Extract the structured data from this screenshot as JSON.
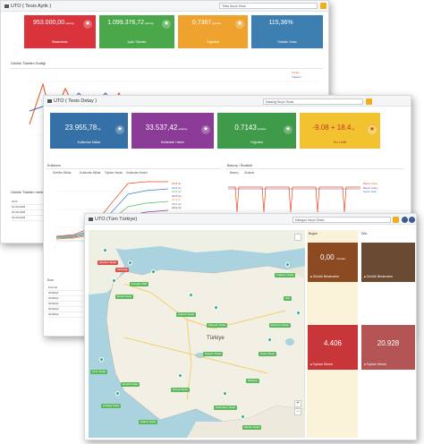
{
  "panel1": {
    "title": "UTO ( Tesis Aylık )",
    "select": "Tesis Seçin Tesis",
    "kpis": [
      {
        "value": "953.000,00",
        "unit": "adet/ay",
        "label": "Beslemeler",
        "color": "#d9343c"
      },
      {
        "value": "1.099.376,72",
        "unit": "adet/ay",
        "label": "Aylık Tüketim",
        "color": "#4aa84a"
      },
      {
        "value": "0,7367",
        "unit": "kg/adet",
        "label": "Yoğunluk",
        "color": "#f0a22e"
      },
      {
        "value": "115,36%",
        "unit": "",
        "label": "Tüketim Oranı",
        "color": "#3c7fb0"
      }
    ],
    "chart_title": "Günlük Tüketim Grafiği",
    "legend": [
      "Üretim",
      "Tüketim"
    ],
    "table_header": "Günlük Tüketim Verileri",
    "table_rows": [
      "Tarih",
      "01.09.2018",
      "02.09.2018",
      "03.09.2018"
    ]
  },
  "panel2": {
    "title": "UTO ( Tesis Detay )",
    "select": "Katalog Seçin Tesisi",
    "kpis": [
      {
        "value": "23.955,78",
        "unit": "kg",
        "label": "Kullanılan Miktar",
        "color": "#3571a6"
      },
      {
        "value": "33.537,42",
        "unit": "adet/ay",
        "label": "Kullanılan Hacim",
        "color": "#8a3c96"
      },
      {
        "value": "0.7143",
        "unit": "kg/adet",
        "label": "Yoğunluk",
        "color": "#3f9a4a"
      },
      {
        "value": "-9.08 + 18.4",
        "unit": "ay",
        "label": "Hız Limiti",
        "color": "#f2c230"
      }
    ],
    "left_header": "Kullanım",
    "left_tabs": [
      "Üretilen Miktar",
      "Kullanılan Miktar",
      "Toplam Hacim",
      "Kullanılan Hacim"
    ],
    "right_header": "Basınç / Sıcaklık",
    "right_tabs": [
      "Basınç",
      "Sıcaklık"
    ],
    "legend_left": [
      "2018 Q1",
      "2018 Q2",
      "2018 Q3",
      "2018 Q4",
      "2019 Q1",
      "2019 Q2",
      "2019 Q3"
    ],
    "legend_right": [
      "Basınç Girişi",
      "Basınç Çıkışı",
      "Hacim Farkı"
    ],
    "table_header": "Kon",
    "table_rows": [
      "Sıra No",
      "2019/Q1",
      "2019/Q1",
      "2019/Q1",
      "2019/Q2",
      "2019/Q2"
    ]
  },
  "panel3": {
    "title": "UTO (Tüm Türkiye)",
    "select": "Kategori Seçin Tesisi",
    "map_tabs": [
      "Harita",
      "Uydu"
    ],
    "country_label": "Türkiye",
    "cities": [
      {
        "name": "İstanbul Tesisi",
        "red": true
      },
      {
        "name": "Tekirdağ",
        "red": true
      },
      {
        "name": "Kocaeli OSB",
        "red": false
      },
      {
        "name": "Bursa Tesisi",
        "red": false
      },
      {
        "name": "Ankara Tesisi",
        "red": false
      },
      {
        "name": "Samsun Tesisi",
        "red": false
      },
      {
        "name": "Trabzon Tesisi",
        "red": false
      },
      {
        "name": "Sivas Tesisi",
        "red": false
      },
      {
        "name": "Kayseri Tesisi",
        "red": false
      },
      {
        "name": "İzmir Tesisi",
        "red": false
      },
      {
        "name": "Denizli Tesisi",
        "red": false
      },
      {
        "name": "Konya Tesisi",
        "red": false
      },
      {
        "name": "Antalya Tesisi",
        "red": false
      },
      {
        "name": "Adana Tesisi",
        "red": false
      },
      {
        "name": "Gaziantep Tesisi",
        "red": false
      },
      {
        "name": "Malatya",
        "red": false
      },
      {
        "name": "Erzurum Tesisi",
        "red": false
      },
      {
        "name": "Van",
        "red": false
      },
      {
        "name": "Mersin Tesisi",
        "red": false
      }
    ],
    "col_headers": [
      "Bugün",
      "Dün"
    ],
    "tiles": [
      {
        "value": "0,00",
        "unit": "m³/adet",
        "label": "Günlük Beslemeler",
        "color": "#8b4a22"
      },
      {
        "value": "",
        "unit": "",
        "label": "Günlük Beslemeler",
        "color": "#6b4a34"
      },
      {
        "value": "4.406",
        "unit": "",
        "label": "Toplam Süresi",
        "color": "#c9363a"
      },
      {
        "value": "20.928",
        "unit": "",
        "label": "Toplam Süresi",
        "color": "#b55454"
      }
    ]
  }
}
